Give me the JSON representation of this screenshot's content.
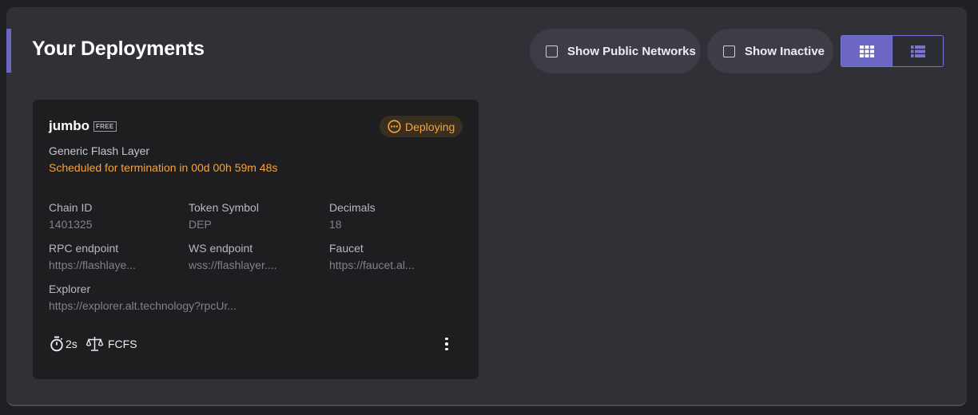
{
  "header": {
    "title": "Your Deployments",
    "show_public_networks_label": "Show Public Networks",
    "show_inactive_label": "Show Inactive",
    "show_public_networks_checked": false,
    "show_inactive_checked": false,
    "view_mode": "grid"
  },
  "colors": {
    "accent": "#6c66c4",
    "status_warning": "#f5a33b",
    "card_background": "#1e1e21",
    "panel_background": "#303036"
  },
  "deployments": [
    {
      "name": "jumbo",
      "tier": "FREE",
      "status": "Deploying",
      "status_icon": "more-horizontal-circle-icon",
      "type": "Generic Flash Layer",
      "termination_notice": "Scheduled for termination in 00d 00h 59m 48s",
      "fields": {
        "chain_id": {
          "label": "Chain ID",
          "value": "1401325"
        },
        "token_symbol": {
          "label": "Token Symbol",
          "value": "DEP"
        },
        "decimals": {
          "label": "Decimals",
          "value": "18"
        },
        "rpc_endpoint": {
          "label": "RPC endpoint",
          "value": "https://flashlaye..."
        },
        "ws_endpoint": {
          "label": "WS endpoint",
          "value": "wss://flashlayer...."
        },
        "faucet": {
          "label": "Faucet",
          "value": "https://faucet.al..."
        },
        "explorer": {
          "label": "Explorer",
          "value": "https://explorer.alt.technology?rpcUr..."
        }
      },
      "block_time": "2s",
      "block_time_icon": "stopwatch-icon",
      "sequencing": "FCFS",
      "sequencing_icon": "scale-icon"
    }
  ]
}
